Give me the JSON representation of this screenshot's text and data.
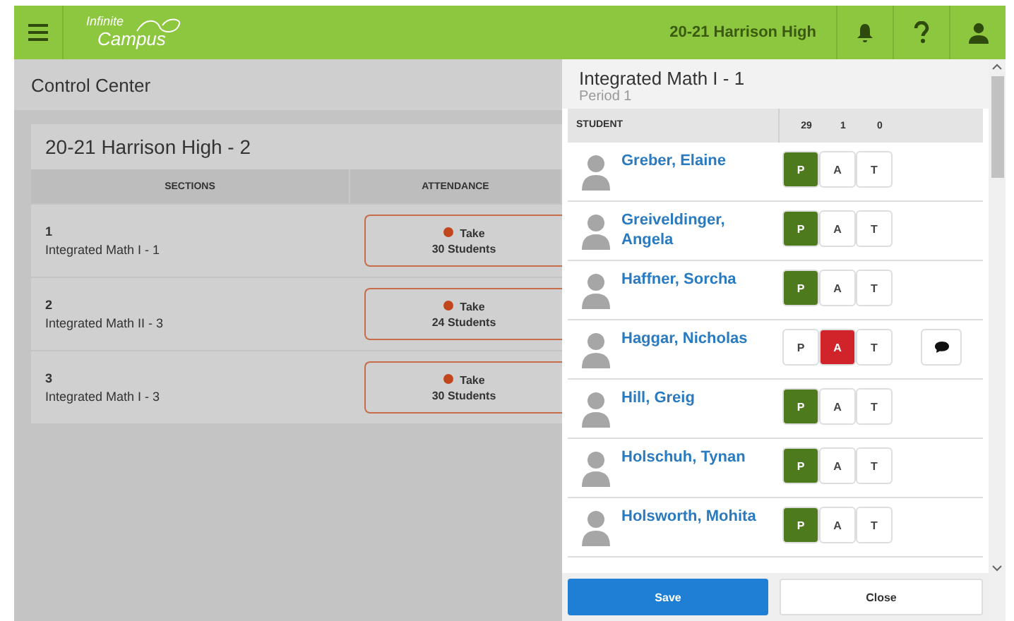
{
  "header": {
    "logo": {
      "line1": "Infinite",
      "line2": "Campus"
    },
    "school": "20-21 Harrison High"
  },
  "page": {
    "title": "Control Center"
  },
  "card": {
    "title": "20-21 Harrison High - 2",
    "columns": [
      "SECTIONS",
      "ATTENDANCE"
    ],
    "rows": [
      {
        "period": "1",
        "course": "Integrated Math I - 1",
        "action": "Take",
        "count": "30 Students"
      },
      {
        "period": "2",
        "course": "Integrated Math II - 3",
        "action": "Take",
        "count": "24 Students"
      },
      {
        "period": "3",
        "course": "Integrated Math I - 3",
        "action": "Take",
        "count": "30 Students"
      }
    ]
  },
  "panel": {
    "title": "Integrated Math I - 1",
    "subtitle": "Period 1",
    "columns": {
      "student": "STUDENT",
      "counts": [
        "29",
        "1",
        "0"
      ]
    },
    "students": [
      {
        "name": "Greber, Elaine",
        "marks": [
          {
            "code": "P",
            "selected": true
          },
          {
            "code": "A",
            "selected": false
          },
          {
            "code": "T",
            "selected": false
          }
        ],
        "comment": false
      },
      {
        "name": "Greiveldinger, Angela",
        "marks": [
          {
            "code": "P",
            "selected": true
          },
          {
            "code": "A",
            "selected": false
          },
          {
            "code": "T",
            "selected": false
          }
        ],
        "comment": false
      },
      {
        "name": "Haffner, Sorcha",
        "marks": [
          {
            "code": "P",
            "selected": true
          },
          {
            "code": "A",
            "selected": false
          },
          {
            "code": "T",
            "selected": false
          }
        ],
        "comment": false
      },
      {
        "name": "Haggar, Nicholas",
        "marks": [
          {
            "code": "P",
            "selected": false
          },
          {
            "code": "A",
            "selected": true
          },
          {
            "code": "T",
            "selected": false
          }
        ],
        "comment": true
      },
      {
        "name": "Hill, Greig",
        "marks": [
          {
            "code": "P",
            "selected": true
          },
          {
            "code": "A",
            "selected": false
          },
          {
            "code": "T",
            "selected": false
          }
        ],
        "comment": false
      },
      {
        "name": "Holschuh, Tynan",
        "marks": [
          {
            "code": "P",
            "selected": true
          },
          {
            "code": "A",
            "selected": false
          },
          {
            "code": "T",
            "selected": false
          }
        ],
        "comment": false
      },
      {
        "name": "Holsworth, Mohita",
        "marks": [
          {
            "code": "P",
            "selected": true
          },
          {
            "code": "A",
            "selected": false
          },
          {
            "code": "T",
            "selected": false
          }
        ],
        "comment": false
      }
    ],
    "buttons": {
      "save": "Save",
      "close": "Close"
    }
  }
}
